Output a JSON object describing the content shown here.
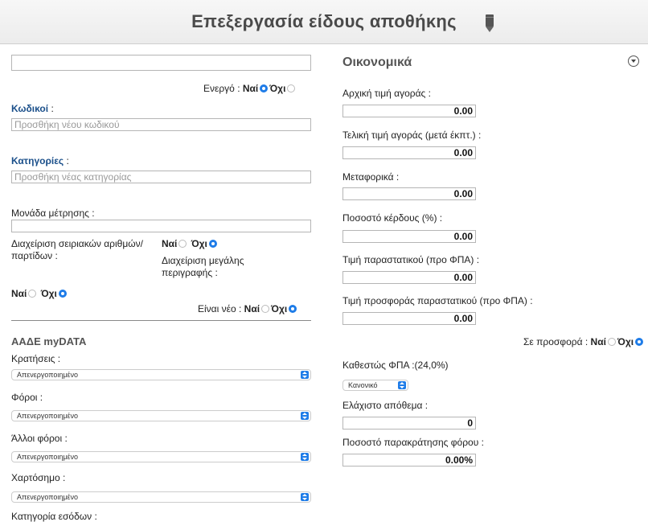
{
  "header": {
    "title": "Επεξεργασία είδους αποθήκης"
  },
  "left": {
    "name_value": "",
    "active": {
      "label": "Ενεργό :",
      "yes": "Ναί",
      "no": "Όχι",
      "selected": "yes"
    },
    "codes": {
      "label": "Κωδικοί",
      "colon": " :",
      "placeholder": "Προσθήκη νέου κωδικού"
    },
    "categories": {
      "label": "Κατηγορίες",
      "colon": " :",
      "placeholder": "Προσθήκη νέας κατηγορίας"
    },
    "unit": {
      "label": "Μονάδα μέτρησης :",
      "value": ""
    },
    "serials": {
      "label_line1": "Διαχείριση σειριακών αριθμών/",
      "label_line2": "παρτίδων :",
      "yes": "Ναί",
      "no": "Όχι",
      "selected": "no"
    },
    "long_desc": {
      "label_line1": "Διαχείριση μεγάλης",
      "label_line2": "περιγραφής :",
      "yes": "Ναί",
      "no": "Όχι",
      "selected": "no"
    },
    "is_new": {
      "label": "Είναι νέο :",
      "yes": "Ναί",
      "no": "Όχι",
      "selected": "no"
    },
    "mydata": {
      "title": "ΑΑΔΕ myDATA",
      "fields": [
        {
          "label": "Κρατήσεις :",
          "value": "Απενεργοποιημένο"
        },
        {
          "label": "Φόροι :",
          "value": "Απενεργοποιημένο"
        },
        {
          "label": "Άλλοι φόροι :",
          "value": "Απενεργοποιημένο"
        },
        {
          "label": "Χαρτόσημο :",
          "value": "Απενεργοποιημένο"
        }
      ],
      "next_label": "Κατηγορία εσόδων :"
    }
  },
  "right": {
    "title": "Οικονομικά",
    "fields": [
      {
        "label": "Αρχική τιμή αγοράς :",
        "value": "0.00"
      },
      {
        "label": "Τελική τιμή αγοράς (μετά έκπτ.) :",
        "value": "0.00"
      },
      {
        "label": "Μεταφορικά :",
        "value": "0.00"
      },
      {
        "label": "Ποσοστό κέρδους (%) :",
        "value": "0.00"
      },
      {
        "label": "Τιμή παραστατικού (προ ΦΠΑ) :",
        "value": "0.00"
      },
      {
        "label": "Τιμή προσφοράς παραστατικού (προ ΦΠΑ) :",
        "value": "0.00"
      }
    ],
    "on_offer": {
      "label": "Σε προσφορά :",
      "yes": "Ναί",
      "no": "Όχι",
      "selected": "no"
    },
    "vat": {
      "label": "Καθεστώς ΦΠΑ :(24,0%)",
      "value": "Κανονικό"
    },
    "min_stock": {
      "label": "Ελάχιστο απόθεμα :",
      "value": "0"
    },
    "withholding": {
      "label": "Ποσοστό παρακράτησης φόρου :",
      "value": "0.00%"
    }
  },
  "colors": {
    "accent": "#1e7ce8",
    "label_blue": "#1a4f8a"
  }
}
